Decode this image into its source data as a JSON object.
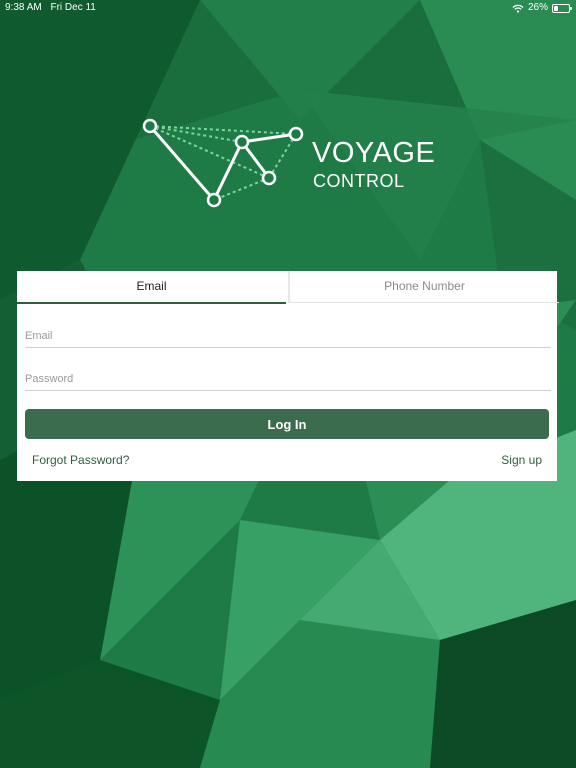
{
  "status_bar": {
    "time": "9:38 AM",
    "date": "Fri Dec 11",
    "battery": "26%",
    "battery_level": 0.26
  },
  "brand": {
    "title": "VOYAGE",
    "subtitle": "CONTROL"
  },
  "login": {
    "tabs": [
      {
        "label": "Email",
        "active": true
      },
      {
        "label": "Phone Number",
        "active": false
      }
    ],
    "email_placeholder": "Email",
    "password_placeholder": "Password",
    "submit_label": "Log In",
    "forgot_label": "Forgot Password?",
    "signup_label": "Sign up"
  },
  "colors": {
    "accent": "#3b6c4d",
    "background": "#1d7a43"
  },
  "icons": [
    "wifi-icon",
    "battery-icon",
    "constellation-logo-icon"
  ]
}
